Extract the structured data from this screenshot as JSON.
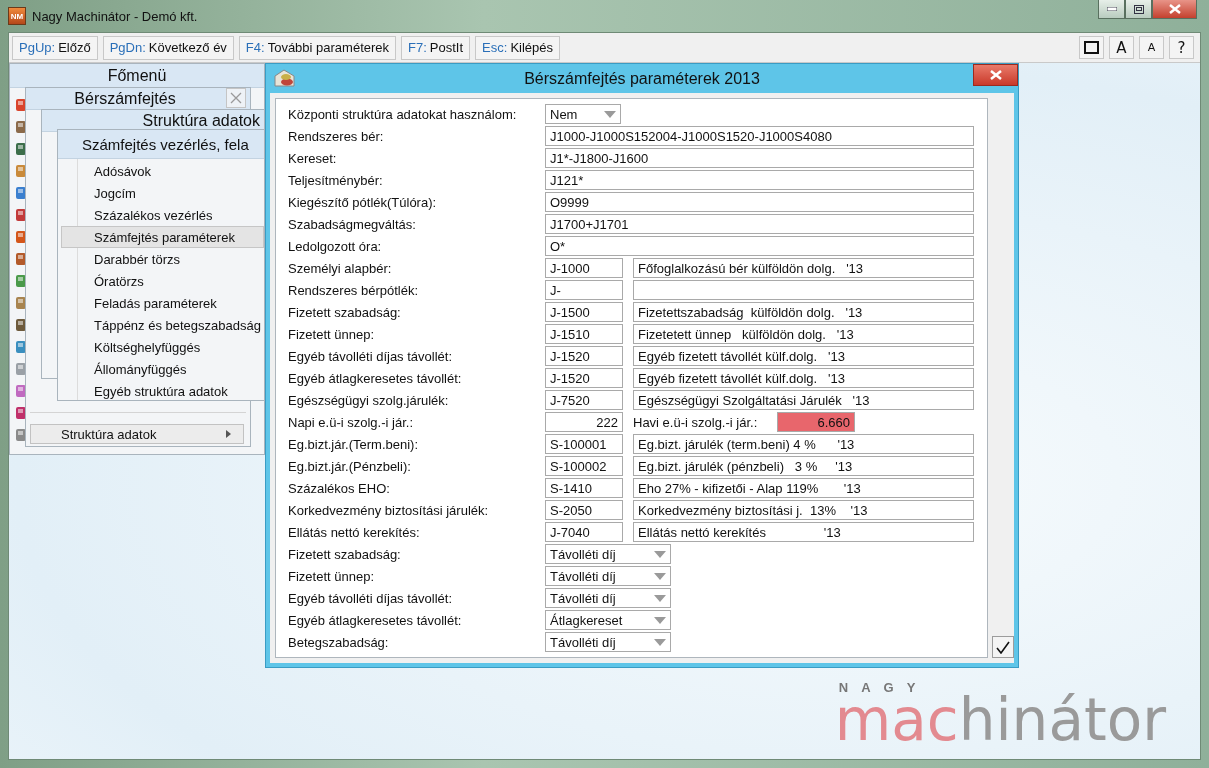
{
  "window": {
    "icon_label": "NM",
    "title": "Nagy Machinátor - Demó kft."
  },
  "toolbar": {
    "buttons": [
      {
        "key": "PgUp:",
        "label": "Előző"
      },
      {
        "key": "PgDn:",
        "label": "Következő év"
      },
      {
        "key": "F4:",
        "label": "További paraméterek"
      },
      {
        "key": "F7:",
        "label": "PostIt"
      },
      {
        "key": "Esc:",
        "label": "Kilépés"
      }
    ],
    "right_buttons": [
      {
        "kind": "frame"
      },
      {
        "kind": "large",
        "label": "A"
      },
      {
        "kind": "small",
        "label": "A"
      },
      {
        "kind": "large",
        "label": "?"
      }
    ]
  },
  "main_menu": {
    "title": "Főmenü"
  },
  "payroll_menu": {
    "title": "Bérszámfejtés",
    "bottom_item": "Struktúra adatok"
  },
  "structure_menu": {
    "title": "Struktúra adatok"
  },
  "control_menu": {
    "title": "Számfejtés vezérlés, fela",
    "items": [
      {
        "label": "Adósávok",
        "selected": false
      },
      {
        "label": "Jogcím",
        "selected": false
      },
      {
        "label": "Százalékos vezérlés",
        "selected": false
      },
      {
        "label": "Számfejtés paraméterek",
        "selected": true
      },
      {
        "label": "Darabbér törzs",
        "selected": false
      },
      {
        "label": "Óratörzs",
        "selected": false
      },
      {
        "label": "Feladás paraméterek",
        "selected": false
      },
      {
        "label": "Táppénz és betegszabadság",
        "selected": false
      },
      {
        "label": "Költséghelyfüggés",
        "selected": false
      },
      {
        "label": "Állományfüggés",
        "selected": false
      },
      {
        "label": "Egyéb struktúra adatok",
        "selected": false
      }
    ]
  },
  "dialog": {
    "title": "Bérszámfejtés paraméterek 2013",
    "rows": [
      {
        "kind": "select",
        "label": "Központi struktúra adatokat használom:",
        "value": "Nem"
      },
      {
        "kind": "wide",
        "label": "Rendszeres bér:",
        "value": "J1000-J1000S152004-J1000S1520-J1000S4080"
      },
      {
        "kind": "wide",
        "label": "Kereset:",
        "value": "J1*-J1800-J1600"
      },
      {
        "kind": "wide",
        "label": "Teljesítménybér:",
        "value": "J121*"
      },
      {
        "kind": "wide",
        "label": "Kiegészítő pótlék(Túlóra):",
        "value": "O9999"
      },
      {
        "kind": "wide",
        "label": "Szabadságmegváltás:",
        "value": "J1700+J1701"
      },
      {
        "kind": "wide",
        "label": "Ledolgozott óra:",
        "value": "O*"
      },
      {
        "kind": "pair",
        "label": "Személyi alapbér:",
        "value": "J-1000",
        "description": "Főfoglalkozású bér külföldön dolg.   '13"
      },
      {
        "kind": "pair",
        "label": "Rendszeres bérpótlék:",
        "value": "J-"
      },
      {
        "kind": "pair",
        "label": "Fizetett szabadság:",
        "value": "J-1500",
        "description": "Fizetettszabadság  külföldön dolg.   '13"
      },
      {
        "kind": "pair",
        "label": "Fizetett ünnep:",
        "value": "J-1510",
        "description": "Fizetetett ünnep   külföldön dolg.   '13"
      },
      {
        "kind": "pair",
        "label": "Egyéb távolléti díjas távollét:",
        "value": "J-1520",
        "description": "Egyéb fizetett távollét külf.dolg.   '13"
      },
      {
        "kind": "pair",
        "label": "Egyéb átlagkeresetes távollét:",
        "value": "J-1520",
        "description": "Egyéb fizetett távollét külf.dolg.   '13"
      },
      {
        "kind": "pair",
        "label": "Egészségügyi szolg.járulék:",
        "value": "J-7520",
        "description": "Egészségügyi Szolgáltatási Járulék   '13"
      },
      {
        "kind": "amounts",
        "label": "Napi e.ü-i szolg.-i jár.:",
        "value": "222",
        "second_label": "Havi e.ü-i szolg.-i jár.:",
        "second_value": "6.660",
        "second_highlighted": true
      },
      {
        "kind": "pair",
        "label": "Eg.bizt.jár.(Term.beni):",
        "value": "S-100001",
        "description": "Eg.bizt. járulék (term.beni) 4 %      '13"
      },
      {
        "kind": "pair",
        "label": "Eg.bizt.jár.(Pénzbeli):",
        "value": "S-100002",
        "description": "Eg.bizt. járulék (pénzbeli)   3 %     '13"
      },
      {
        "kind": "pair",
        "label": "Százalékos EHO:",
        "value": "S-1410",
        "description": "Eho 27% - kifizetői - Alap 119%       '13"
      },
      {
        "kind": "pair",
        "label": "Korkedvezmény biztosítási járulék:",
        "value": "S-2050",
        "description": "Korkedvezmény biztosítási j.  13%    '13"
      },
      {
        "kind": "pair",
        "label": "Ellátás nettó kerekítés:",
        "value": "J-7040",
        "description": "Ellátás nettó kerekítés                '13"
      },
      {
        "kind": "dropdown",
        "label": "Fizetett szabadság:",
        "value": "Távolléti díj"
      },
      {
        "kind": "dropdown",
        "label": "Fizetett ünnep:",
        "value": "Távolléti díj"
      },
      {
        "kind": "dropdown",
        "label": "Egyéb távolléti díjas távollét:",
        "value": "Távolléti díj"
      },
      {
        "kind": "dropdown",
        "label": "Egyéb átlagkeresetes távollét:",
        "value": "Átlagkereset"
      },
      {
        "kind": "dropdown",
        "label": "Betegszabadság:",
        "value": "Távolléti díj"
      }
    ]
  },
  "logo": {
    "small": "NAGY",
    "part1": "mac",
    "part2": "hinátor"
  }
}
